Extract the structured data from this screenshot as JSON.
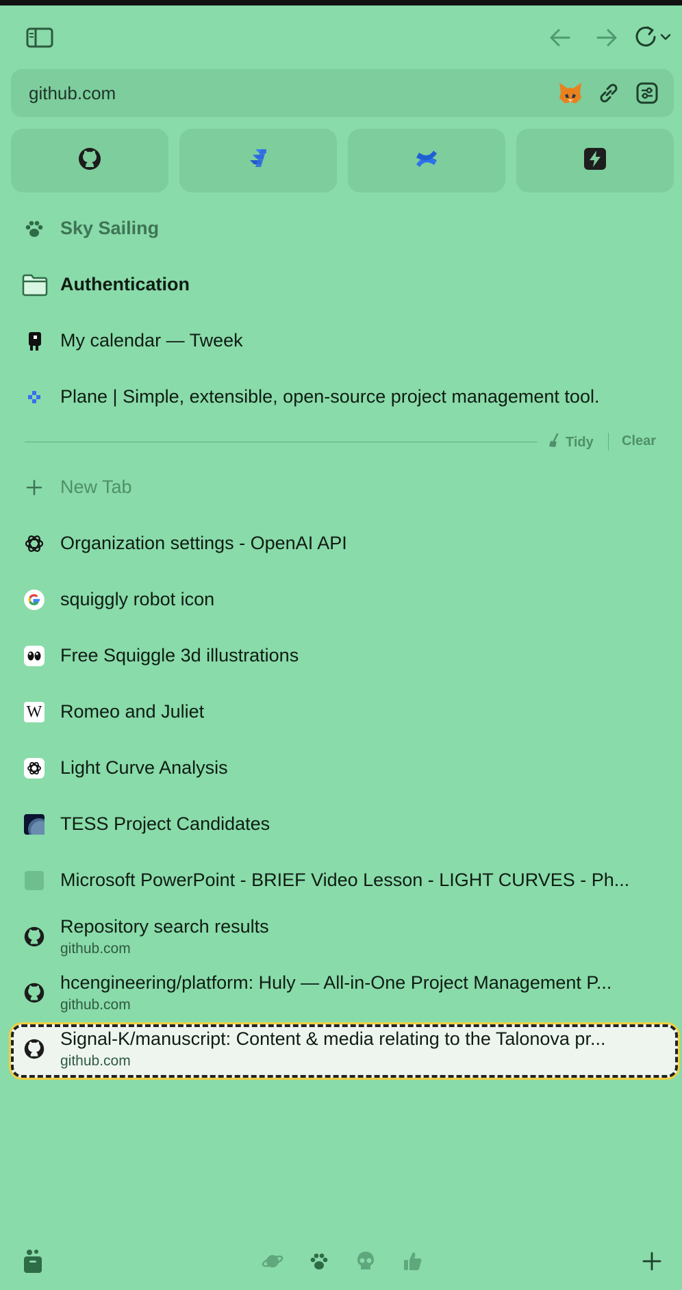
{
  "window": {
    "url": "github.com"
  },
  "toolbar": {
    "sidebar_icon": "sidebar-toggle-icon",
    "back_icon": "arrow-left-icon",
    "forward_icon": "arrow-right-icon",
    "reload_icon": "reload-icon"
  },
  "pinned": [
    {
      "icon": "github-icon"
    },
    {
      "icon": "jira-icon"
    },
    {
      "icon": "confluence-icon"
    },
    {
      "icon": "bolt-icon"
    }
  ],
  "space": {
    "name": "Sky Sailing"
  },
  "folder": {
    "name": "Authentication"
  },
  "pinned_tabs": [
    {
      "title": "My calendar — Tweek"
    },
    {
      "title": "Plane | Simple, extensible, open-source project management tool."
    }
  ],
  "actions": {
    "tidy": "Tidy",
    "clear": "Clear",
    "new_tab": "New Tab"
  },
  "tabs": [
    {
      "title": "Organization settings - OpenAI API"
    },
    {
      "title": "squiggly robot icon"
    },
    {
      "title": "Free Squiggle 3d illustrations"
    },
    {
      "title": "Romeo and Juliet"
    },
    {
      "title": "Light Curve Analysis"
    },
    {
      "title": "TESS Project Candidates"
    },
    {
      "title": "Microsoft PowerPoint - BRIEF Video Lesson - LIGHT CURVES - Ph..."
    },
    {
      "title": "Repository search results",
      "sub": "github.com"
    },
    {
      "title": "hcengineering/platform: Huly — All-in-One Project Management P...",
      "sub": "github.com"
    },
    {
      "title": "Signal-K/manuscript: Content & media relating to the Talonova pr...",
      "sub": "github.com"
    }
  ],
  "colors": {
    "background": "#89dba9",
    "selected": "#eef5ef",
    "highlight": "#f0d040"
  }
}
